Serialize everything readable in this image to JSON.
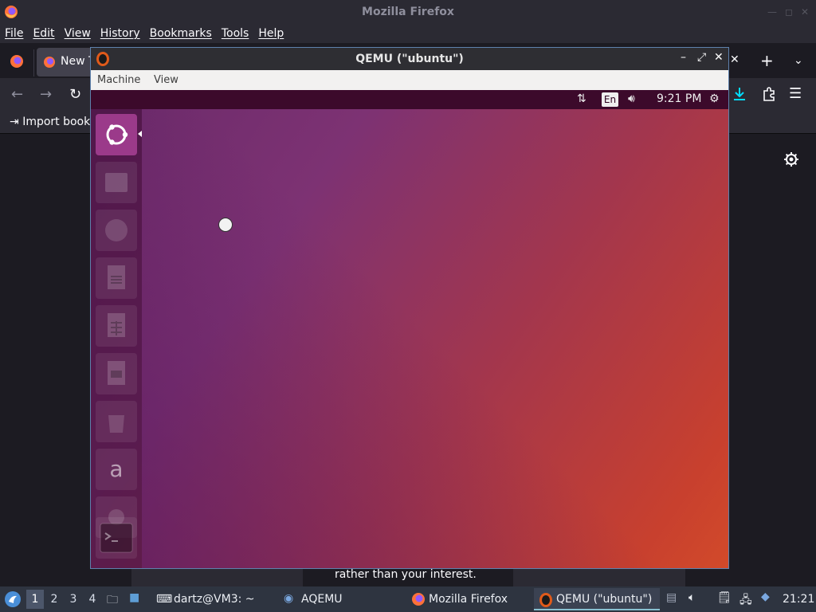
{
  "firefox": {
    "window_title": "Mozilla Firefox",
    "menu": [
      "File",
      "Edit",
      "View",
      "History",
      "Bookmarks",
      "Tools",
      "Help"
    ],
    "tab_label": "New Tab",
    "bookmarks_toolbar": {
      "import_label": "Import bookmarks..."
    },
    "content_snippet": "rather than your interest."
  },
  "qemu": {
    "window_title": "QEMU (\"ubuntu\")",
    "menu": [
      "Machine",
      "View"
    ],
    "guest": {
      "language_indicator": "En",
      "clock": "9:21 PM",
      "launcher_items": [
        "ubuntu-dash-icon",
        "files-icon",
        "firefox-icon",
        "writer-icon",
        "calc-icon",
        "impress-icon",
        "software-center-icon",
        "amazon-icon",
        "system-settings-icon",
        "terminal-icon"
      ]
    }
  },
  "taskbar": {
    "workspaces": [
      "1",
      "2",
      "3",
      "4"
    ],
    "active_workspace": "1",
    "tasks": [
      {
        "label": "dartz@VM3: ~",
        "icon": "terminal-icon"
      },
      {
        "label": "AQEMU",
        "icon": "aqemu-icon"
      },
      {
        "label": "Mozilla Firefox",
        "icon": "firefox-icon"
      },
      {
        "label": "QEMU (\"ubuntu\")",
        "icon": "qemu-icon"
      }
    ],
    "clock": "21:21"
  },
  "colors": {
    "firefox_chrome": "#2b2a33",
    "firefox_bg": "#1c1b22",
    "qemu_border": "#5e81ac",
    "ubuntu_topbar": "#3c0a2b",
    "ubuntu_dash": "#9b3a8a",
    "taskbar_bg": "#2e3440"
  }
}
